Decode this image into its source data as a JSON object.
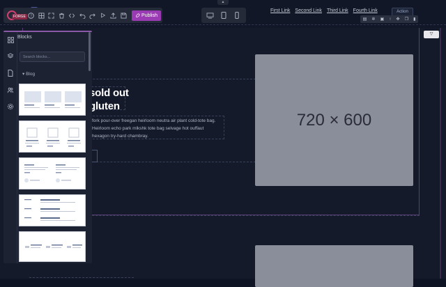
{
  "toolbar": {
    "logo_tag": "FORGE",
    "publish_label": "Publish"
  },
  "nav": {
    "links": [
      "First Link",
      "Second Link",
      "Third Link",
      "Fourth Link"
    ],
    "action_label": "Action"
  },
  "hero": {
    "title_line1": "sold out",
    "title_line2": "gluten",
    "description": "fork pour-over freegan heirloom neutra air plant cold-tote bag. Heirloom echo park mlkshk tote bag selvage hot ouffaut hexagon try-hard chambray."
  },
  "image_placeholder_label": "720 × 600",
  "panel": {
    "title": "Blocks",
    "search_placeholder": "Search blocks...",
    "category": "Blog"
  },
  "icons": {
    "rail": [
      "grid-icon",
      "layers-icon",
      "page-icon",
      "people-icon",
      "gear-icon"
    ]
  },
  "colors": {
    "accent": "#9b3bb3",
    "panel_bg": "#1d2232",
    "canvas_bg": "#141a2a",
    "placeholder": "#8a8d9a"
  }
}
